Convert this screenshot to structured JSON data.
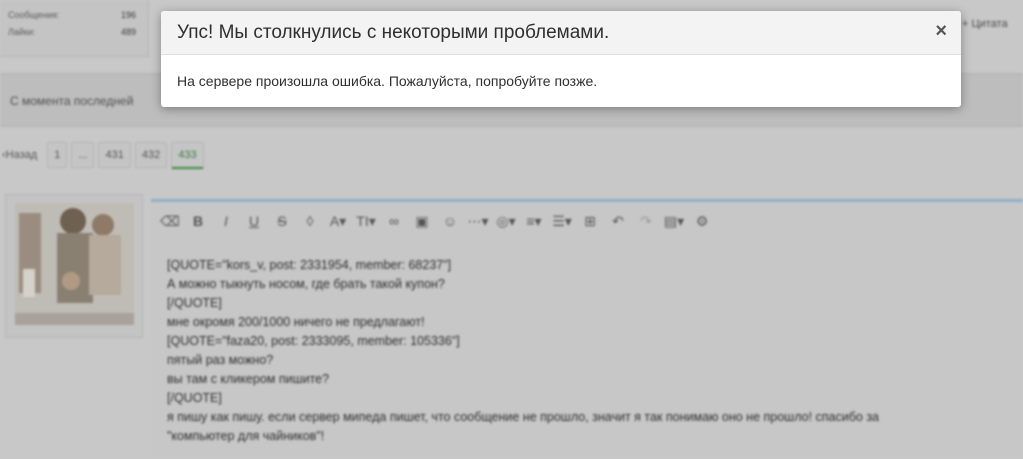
{
  "stats": {
    "rows": [
      {
        "label": "Сообщения:",
        "value": "196"
      },
      {
        "label": "Лайки:",
        "value": "489"
      }
    ]
  },
  "quote_button": "+ Цитата",
  "banner": {
    "text": "С момента последней"
  },
  "pager": {
    "back": "‹Назад",
    "pages": [
      "1",
      "...",
      "431",
      "432",
      "433"
    ],
    "active": "433"
  },
  "editor": {
    "toolbar_icons": [
      "eraser-icon",
      "bold-icon",
      "italic-icon",
      "underline-icon",
      "strikethrough-icon",
      "text-color-icon",
      "font-family-icon",
      "font-size-icon",
      "link-icon",
      "image-icon",
      "smiley-icon",
      "more-icon",
      "hide-icon",
      "align-icon",
      "list-icon",
      "table-icon",
      "undo-icon",
      "redo-icon",
      "drafts-icon",
      "settings-icon"
    ],
    "lines": [
      "[QUOTE=\"kors_v, post: 2331954, member: 68237\"]",
      "А можно тыкнуть носом, где брать такой купон?",
      "[/QUOTE]",
      "мне окромя 200/1000 ничего не предлагают!",
      "[QUOTE=\"faza20, post: 2333095, member: 105336\"]",
      "пятый раз можно?",
      "вы там с кликером пишите?",
      "[/QUOTE]",
      "я пишу как пишу. если сервер мипеда пишет, что сообщение не прошло, значит я так понимаю оно не прошло! спасибо за",
      "\"компьютер для чайников\"!"
    ]
  },
  "modal": {
    "title": "Упс! Мы столкнулись с некоторыми проблемами.",
    "message": "На сервере произошла ошибка. Пожалуйста, попробуйте позже.",
    "close": "×"
  }
}
